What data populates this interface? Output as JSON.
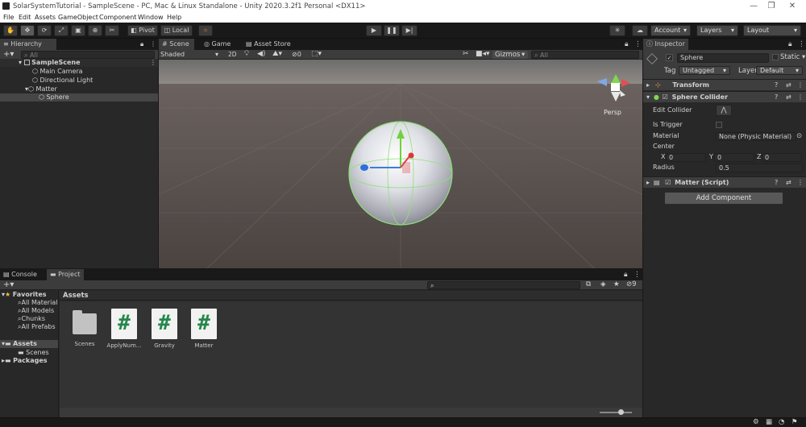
{
  "window": {
    "title": "SolarSystemTutorial - SampleScene - PC, Mac & Linux Standalone - Unity 2020.3.2f1 Personal <DX11>"
  },
  "menu": [
    "File",
    "Edit",
    "Assets",
    "GameObject",
    "Component",
    "Window",
    "Help"
  ],
  "toolbar": {
    "pivot_label": "Pivot",
    "local_label": "Local",
    "account_label": "Account",
    "layers_label": "Layers",
    "layout_label": "Layout"
  },
  "hierarchy": {
    "tab_label": "Hierarchy",
    "search_placeholder": "All",
    "scene_name": "SampleScene",
    "items": [
      "Main Camera",
      "Directional Light",
      "Matter",
      "Sphere"
    ]
  },
  "scene_view": {
    "tabs": [
      "Scene",
      "Game",
      "Asset Store"
    ],
    "draw_mode": "Shaded",
    "mode_2d": "2D",
    "fx_count": "0",
    "gizmos_label": "Gizmos",
    "search_placeholder": "All",
    "persp_label": "Persp"
  },
  "inspector": {
    "tab_label": "Inspector",
    "object_name": "Sphere",
    "static_label": "Static",
    "tag_label": "Tag",
    "tag_value": "Untagged",
    "layer_label": "Layer",
    "layer_value": "Default",
    "transform_label": "Transform",
    "collider_label": "Sphere Collider",
    "edit_collider_label": "Edit Collider",
    "is_trigger_label": "Is Trigger",
    "material_label": "Material",
    "material_value": "None (Physic Material)",
    "center_label": "Center",
    "center": {
      "x_label": "X",
      "x": "0",
      "y_label": "Y",
      "y": "0",
      "z_label": "Z",
      "z": "0"
    },
    "radius_label": "Radius",
    "radius_value": "0.5",
    "script_label": "Matter (Script)",
    "add_component_label": "Add Component"
  },
  "bottom": {
    "tabs": [
      "Console",
      "Project"
    ],
    "hidden_count": "9",
    "favorites_label": "Favorites",
    "favorites": [
      "All Material",
      "All Models",
      "Chunks",
      "All Prefabs"
    ],
    "assets_label": "Assets",
    "asset_children": [
      "Scenes"
    ],
    "packages_label": "Packages",
    "breadcrumb": "Assets",
    "asset_items": [
      {
        "name": "Scenes",
        "kind": "folder"
      },
      {
        "name": "ApplyNum...",
        "kind": "script"
      },
      {
        "name": "Gravity",
        "kind": "script"
      },
      {
        "name": "Matter",
        "kind": "script"
      }
    ],
    "script_glyph": "#"
  }
}
